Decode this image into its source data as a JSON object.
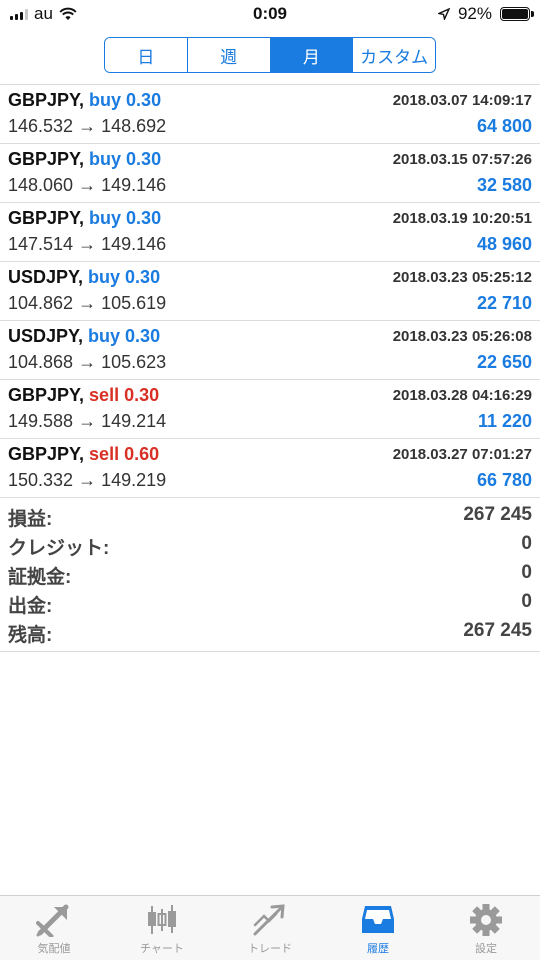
{
  "status_bar": {
    "carrier": "au",
    "time": "0:09",
    "battery_percent": "92%",
    "battery_level": 0.92
  },
  "segments": [
    {
      "label": "日",
      "active": false
    },
    {
      "label": "週",
      "active": false
    },
    {
      "label": "月",
      "active": true
    },
    {
      "label": "カスタム",
      "active": false
    }
  ],
  "deals": [
    {
      "symbol": "GBPJPY,",
      "side": "buy 0.30",
      "type": "buy",
      "datetime": "2018.03.07 14:09:17",
      "prices": "146.532 → 148.692",
      "profit": "64 800"
    },
    {
      "symbol": "GBPJPY,",
      "side": "buy 0.30",
      "type": "buy",
      "datetime": "2018.03.15 07:57:26",
      "prices": "148.060 → 149.146",
      "profit": "32 580"
    },
    {
      "symbol": "GBPJPY,",
      "side": "buy 0.30",
      "type": "buy",
      "datetime": "2018.03.19 10:20:51",
      "prices": "147.514 → 149.146",
      "profit": "48 960"
    },
    {
      "symbol": "USDJPY,",
      "side": "buy 0.30",
      "type": "buy",
      "datetime": "2018.03.23 05:25:12",
      "prices": "104.862 → 105.619",
      "profit": "22 710"
    },
    {
      "symbol": "USDJPY,",
      "side": "buy 0.30",
      "type": "buy",
      "datetime": "2018.03.23 05:26:08",
      "prices": "104.868 → 105.623",
      "profit": "22 650"
    },
    {
      "symbol": "GBPJPY,",
      "side": "sell 0.30",
      "type": "sell",
      "datetime": "2018.03.28 04:16:29",
      "prices": "149.588 → 149.214",
      "profit": "11 220"
    },
    {
      "symbol": "GBPJPY,",
      "side": "sell 0.60",
      "type": "sell",
      "datetime": "2018.03.27 07:01:27",
      "prices": "150.332 → 149.219",
      "profit": "66 780"
    }
  ],
  "summary": [
    {
      "label": "損益:",
      "value": "267 245"
    },
    {
      "label": "クレジット:",
      "value": "0"
    },
    {
      "label": "証拠金:",
      "value": "0"
    },
    {
      "label": "出金:",
      "value": "0"
    },
    {
      "label": "残高:",
      "value": "267 245"
    }
  ],
  "tabs": [
    {
      "label": "気配値",
      "icon": "quotes-icon",
      "active": false
    },
    {
      "label": "チャート",
      "icon": "candlestick-chart-icon",
      "active": false
    },
    {
      "label": "トレード",
      "icon": "trade-icon",
      "active": false
    },
    {
      "label": "履歴",
      "icon": "history-inbox-icon",
      "active": true
    },
    {
      "label": "設定",
      "icon": "gear-icon",
      "active": false
    }
  ],
  "colors": {
    "accent": "#1a7be0",
    "sell": "#d93025",
    "tab_inactive": "#9a9a9a"
  }
}
